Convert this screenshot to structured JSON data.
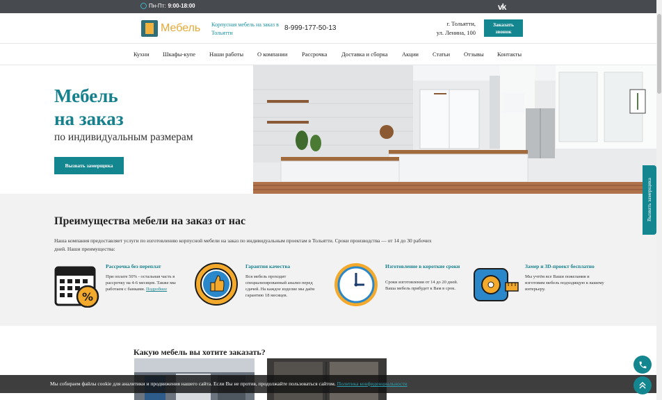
{
  "topbar": {
    "hours_prefix": "Пн-Пт:",
    "hours_value": "9:00-18:00",
    "vk_label": "vk"
  },
  "header": {
    "logo_text": "Мебель",
    "tagline": "Корпусная мебель на заказ в Тольятти",
    "phone": "8-999-177-50-13",
    "address_line1": "г. Тольятти,",
    "address_line2": "ул. Ленина, 100",
    "call_button_line1": "Заказать",
    "call_button_line2": "звонок"
  },
  "nav": {
    "items": [
      "Кухни",
      "Шкафы-купе",
      "Наши работы",
      "О компании",
      "Рассрочка",
      "Доставка и сборка",
      "Акции",
      "Статьи",
      "Отзывы",
      "Контакты"
    ]
  },
  "hero": {
    "title_line1": "Мебель",
    "title_line2": "на заказ",
    "subtitle": "по индивидуальным размерам",
    "cta": "Вызвать замерщика"
  },
  "advantages": {
    "title": "Преимущества мебели на заказ от нас",
    "intro": "Наша компания предоставляет услуги по изготовлению корпусной мебели на заказ по индивидуальным проектам в Тольятти. Сроки производства — от 14 до 30 рабочих дней. Наши преимущества:",
    "items": [
      {
        "title": "Рассрочка без переплат",
        "text": "При оплате 50% - остальная часть в рассрочку на 4-6 месяцев. Также мы работаем с банками.",
        "link": "Подробнее",
        "icon": "calendar-percent-icon"
      },
      {
        "title": "Гарантия качества",
        "text": "Вся мебель проходит специализированный анализ перед сдачей. На каждое изделие мы даём гарантию 18 месяцев.",
        "icon": "quality-badge-icon"
      },
      {
        "title": "Изготовление в короткие сроки",
        "text": "Сроки изготовления от 14 до 20 дней. Ваша мебель прибудет к Вам в срок.",
        "icon": "clock-icon"
      },
      {
        "title": "Замер и 3D-проект бесплатно",
        "text": "Мы учтём все Ваши пожелания и изготовим мебель подходящую к вашему интерьеру.",
        "icon": "tape-measure-icon"
      }
    ]
  },
  "catalog": {
    "title": "Какую мебель вы хотите заказать?"
  },
  "cookie": {
    "text": "Мы собираем файлы cookie для аналитики и продвижения нашего сайта. Если Вы не против, продолжайте пользоваться сайтом.",
    "link": "Политика конфиденциальности"
  },
  "side_tab": {
    "label": "Вызвать замерщика"
  },
  "colors": {
    "accent": "#13868f",
    "logo_orange": "#e7a935",
    "topbar": "#474a4f"
  }
}
